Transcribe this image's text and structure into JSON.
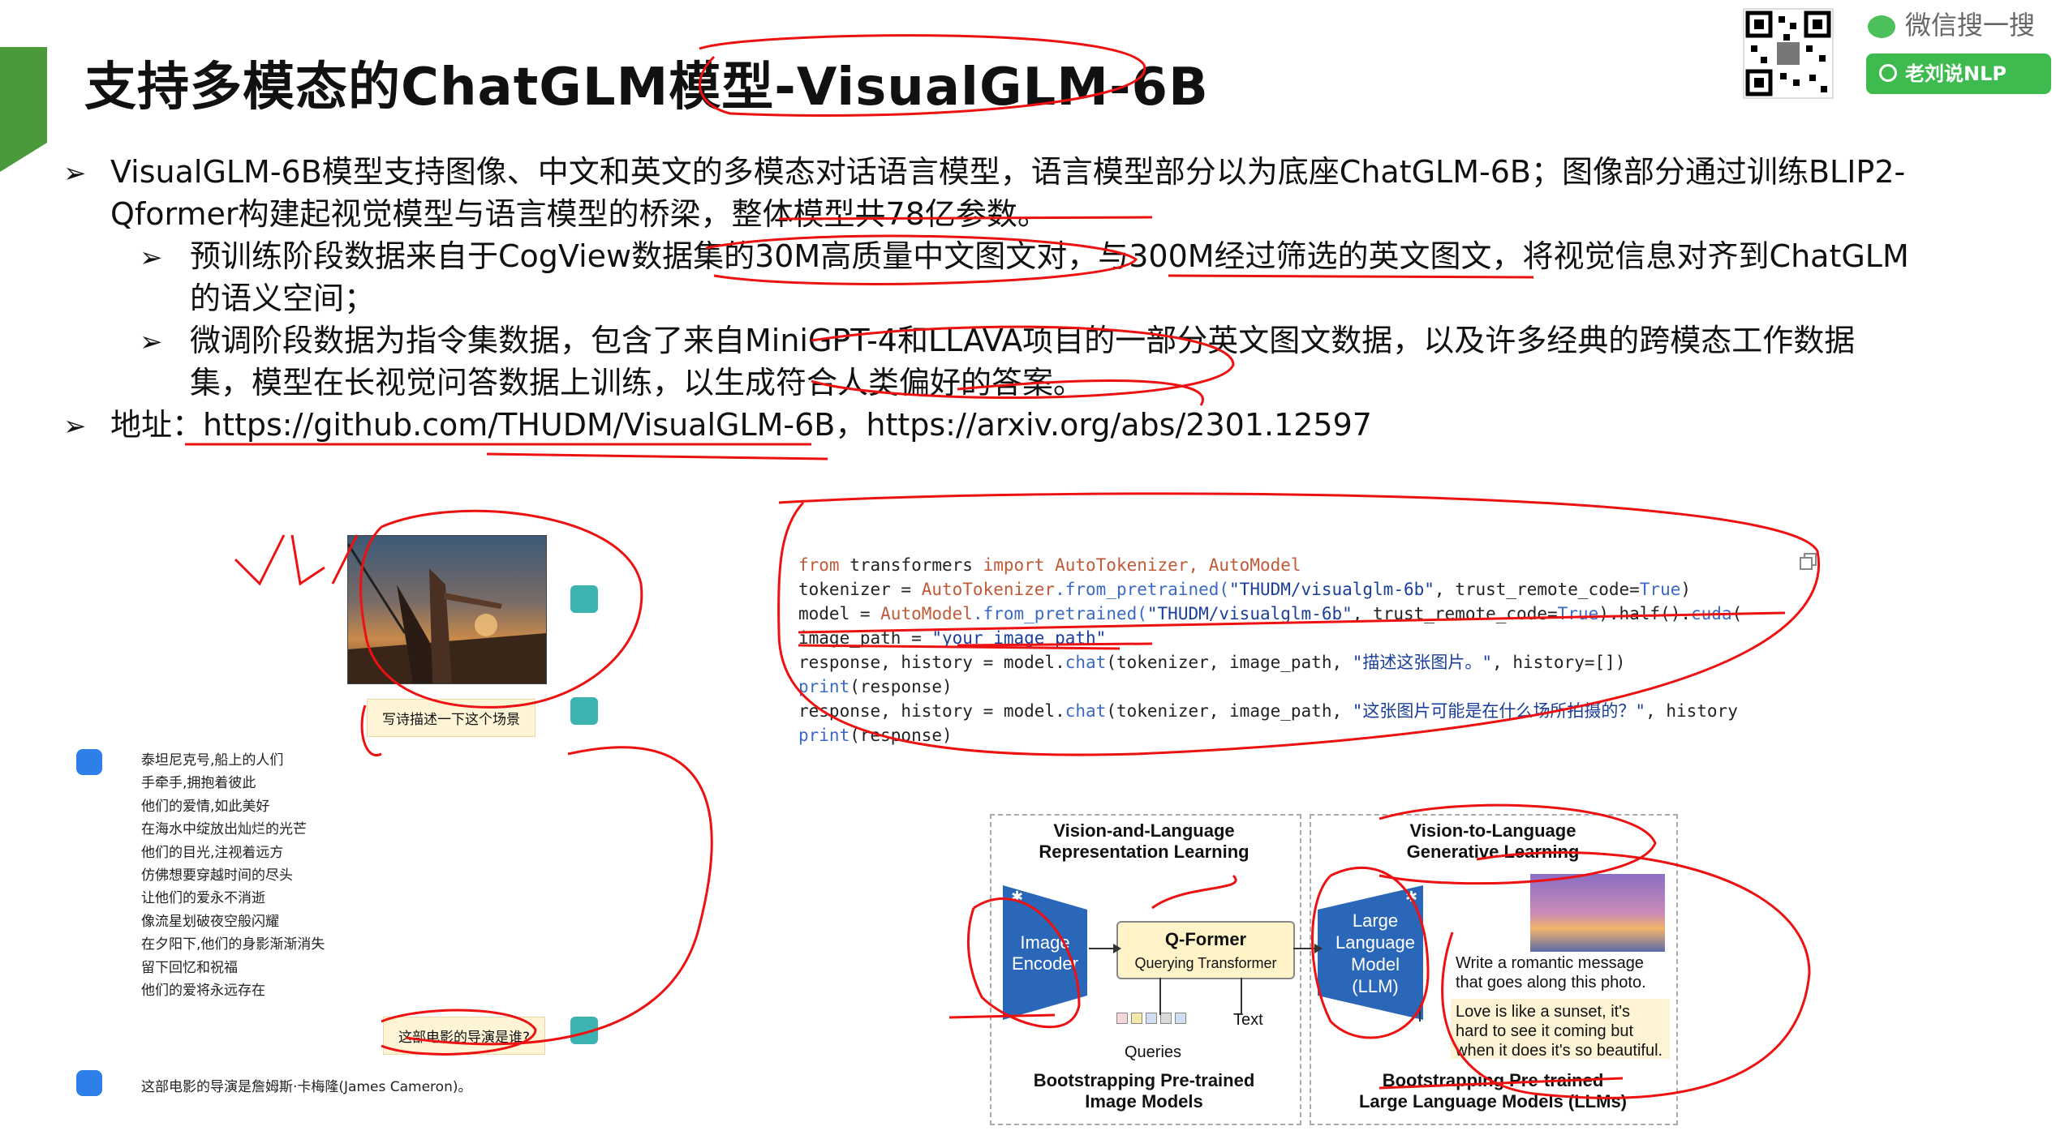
{
  "header": {
    "title": "支持多模态的ChatGLM模型-VisualGLM-6B",
    "wechat_label": "微信搜一搜",
    "search_label": "老刘说NLP"
  },
  "bullets": [
    {
      "text_line1": "VisualGLM-6B模型支持图像、中文和英文的多模态对话语言模型，语言模型部分以为底座ChatGLM-6B；图像部分通过训练BLIP2-",
      "text_line2": "Qformer构建起视觉模型与语言模型的桥梁，整体模型共78亿参数。"
    },
    {
      "text_line1": "预训练阶段数据来自于CogView数据集的30M高质量中文图文对，与300M经过筛选的英文图文，将视觉信息对齐到ChatGLM",
      "text_line2": "的语义空间；"
    },
    {
      "text_line1": "微调阶段数据为指令集数据，包含了来自MiniGPT-4和LLAVA项目的一部分英文图文数据，以及许多经典的跨模态工作数据",
      "text_line2": "集，模型在长视觉问答数据上训练，以生成符合人类偏好的答案。"
    },
    {
      "text_line1": "地址：https://github.com/THUDM/VisualGLM-6B，https://arxiv.org/abs/2301.12597"
    }
  ],
  "chat": {
    "prompt1": "写诗描述一下这个场景",
    "poem": [
      "泰坦尼克号,船上的人们",
      "手牵手,拥抱着彼此",
      "他们的爱情,如此美好",
      "在海水中绽放出灿烂的光芒",
      "他们的目光,注视着远方",
      "仿佛想要穿越时间的尽头",
      "让他们的爱永不消逝",
      "像流星划破夜空般闪耀",
      "在夕阳下,他们的身影渐渐消失",
      "留下回忆和祝福",
      "他们的爱将永远存在"
    ],
    "prompt2": "这部电影的导演是谁?",
    "answer": "这部电影的导演是詹姆斯·卡梅隆(James Cameron)。"
  },
  "code": {
    "l1": {
      "a": "from",
      "b": " transformers ",
      "c": "import",
      "d": " AutoTokenizer, AutoModel"
    },
    "l2": {
      "a": "tokenizer = ",
      "b": "AutoTokenizer",
      "c": ".from_pretrained(",
      "d": "\"THUDM/visualglm-6b\"",
      "e": ", trust_remote_code=",
      "f": "True",
      "g": ")"
    },
    "l3": {
      "a": "model = ",
      "b": "AutoModel",
      "c": ".from_pretrained(",
      "d": "\"THUDM/visualglm-6b\"",
      "e": ", trust_remote_code=",
      "f": "True",
      "g": ").half().",
      "h": "cuda",
      "i": "("
    },
    "l4": {
      "a": "image_path = ",
      "b": "\"your image path\""
    },
    "l5": {
      "a": "response, history = model.",
      "b": "chat",
      "c": "(tokenizer, image_path, ",
      "d": "\"描述这张图片。\"",
      "e": ", history=[])"
    },
    "l6": {
      "a": "print",
      "b": "(response)"
    },
    "l7": {
      "a": "response, history = model.",
      "b": "chat",
      "c": "(tokenizer, image_path, ",
      "d": "\"这张图片可能是在什么场所拍摄的？\"",
      "e": ", history"
    },
    "l8": {
      "a": "print",
      "b": "(response)"
    }
  },
  "diagram": {
    "left_title": "Vision-and-Language\nRepresentation Learning",
    "right_title": "Vision-to-Language\nGenerative Learning",
    "image_encoder": "Image\nEncoder",
    "qformer_title": "Q-Former",
    "qformer_sub": "Querying Transformer",
    "llm": "Large\nLanguage\nModel\n(LLM)",
    "text_label": "Text",
    "queries_label": "Queries",
    "left_footer": "Bootstrapping Pre-trained\nImage Models",
    "right_footer": "Bootstrapping Pre-trained\nLarge Language Models (LLMs)",
    "prompt": "Write a romantic message\nthat goes along this photo.",
    "response": "Love is like a sunset, it's\nhard to see it coming but\nwhen it does it's so beautiful."
  }
}
